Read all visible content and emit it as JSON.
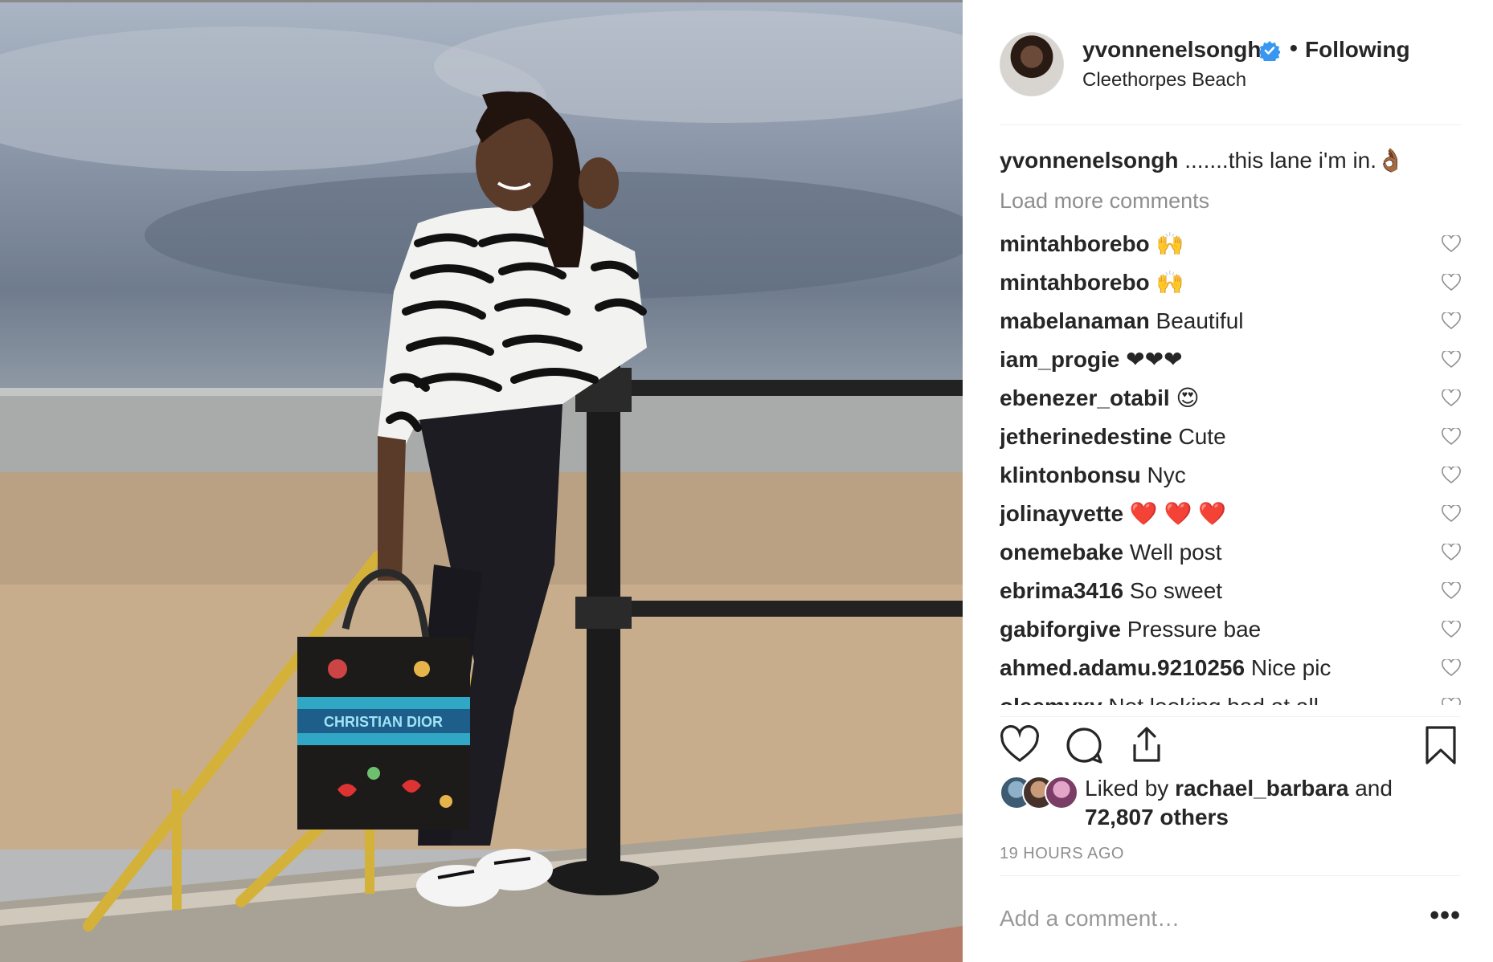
{
  "post": {
    "username": "yvonnenelsongh",
    "follow_separator": "•",
    "follow_status": "Following",
    "location": "Cleethorpes Beach",
    "photo_bag_text": "CHRISTIAN DIOR"
  },
  "caption": {
    "username": "yvonnenelsongh",
    "text": ".......this lane i'm in.👌🏾"
  },
  "load_more_label": "Load more comments",
  "comments": [
    {
      "user": "mintahborebo",
      "text": "🙌"
    },
    {
      "user": "mintahborebo",
      "text": "🙌"
    },
    {
      "user": "mabelanaman",
      "text": "Beautiful"
    },
    {
      "user": "iam_progie",
      "text": "❤❤❤"
    },
    {
      "user": "ebenezer_otabil",
      "text": "😍"
    },
    {
      "user": "jetherinedestine",
      "text": "Cute"
    },
    {
      "user": "klintonbonsu",
      "text": "Nyc"
    },
    {
      "user": "jolinayvette",
      "text": "❤️ ❤️ ❤️"
    },
    {
      "user": "onemebake",
      "text": "Well post"
    },
    {
      "user": "ebrima3416",
      "text": "So sweet"
    },
    {
      "user": "gabiforgive",
      "text": "Pressure bae"
    },
    {
      "user": "ahmed.adamu.9210256",
      "text": "Nice pic"
    },
    {
      "user": "oleemyxy",
      "text": "Not looking bad at all"
    }
  ],
  "likes": {
    "prefix": "Liked by",
    "user": "rachael_barbara",
    "conjunction": "and",
    "others": "72,807 others"
  },
  "timestamp": "19 HOURS AGO",
  "add_comment_placeholder": "Add a comment…",
  "more_options": "•••",
  "icons": [
    "verified-badge-icon",
    "heart-icon",
    "comment-icon",
    "share-icon",
    "bookmark-icon",
    "more-options-icon"
  ],
  "colors": {
    "text": "#262626",
    "secondary": "#8e8e8e",
    "verified": "#3897f0",
    "divider": "#efefef"
  }
}
